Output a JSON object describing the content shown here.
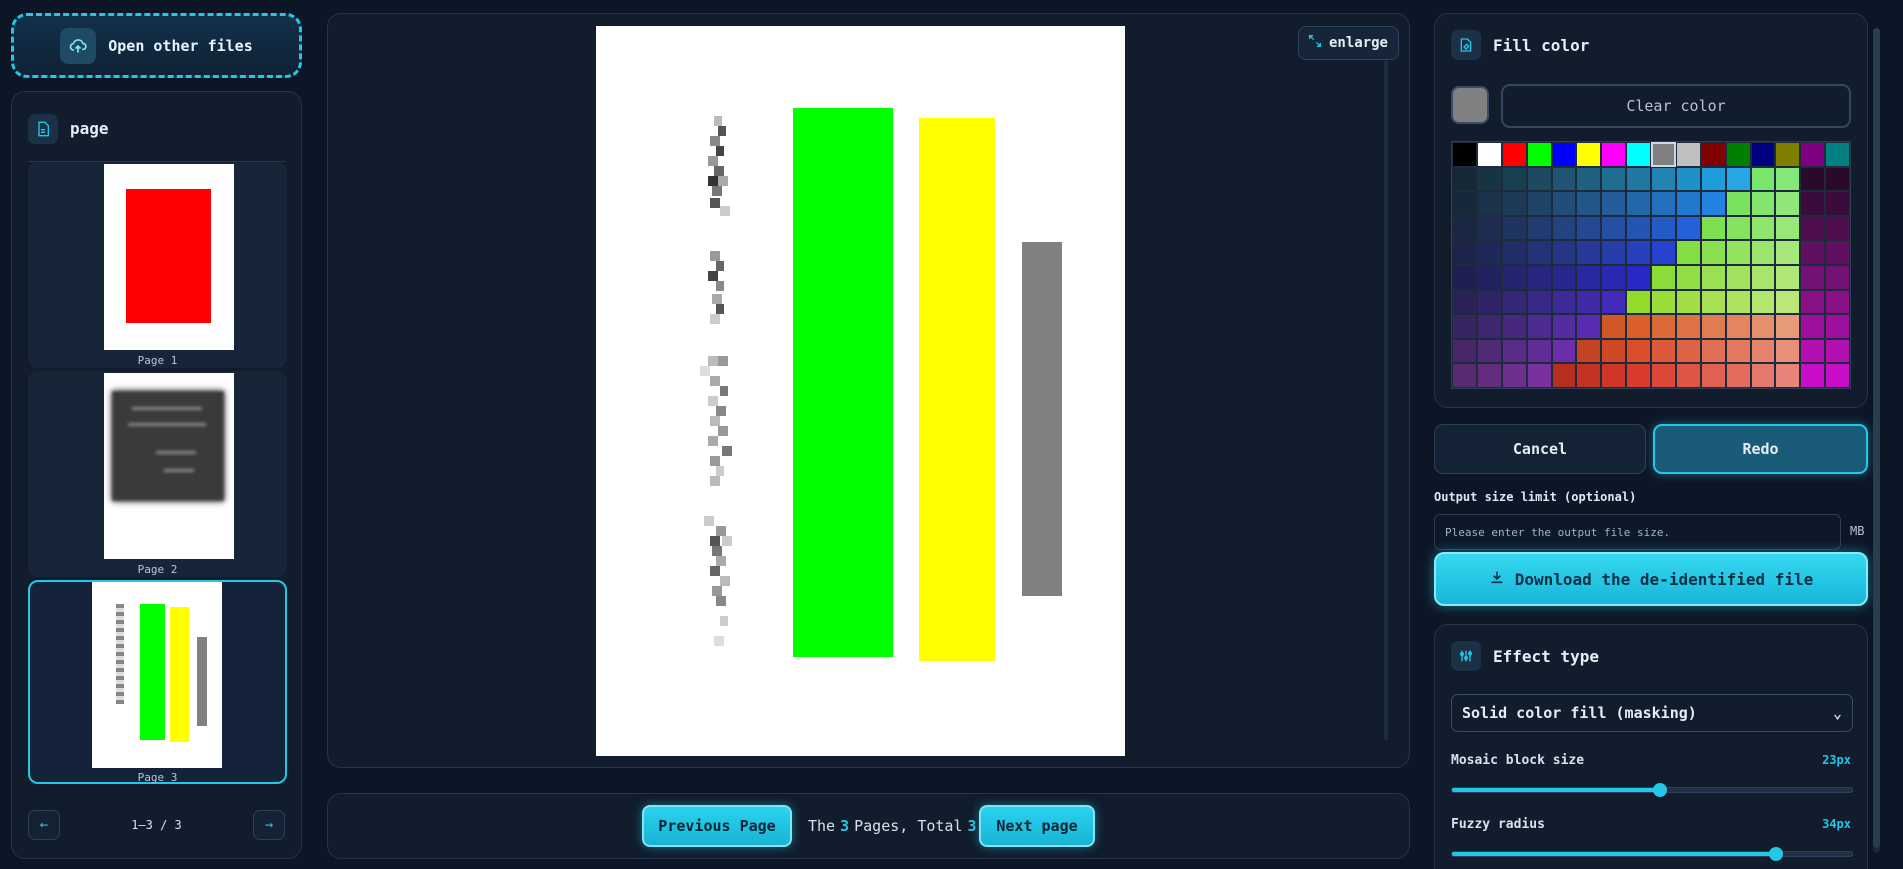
{
  "open_button": {
    "label": "Open other files",
    "icon": "cloud-upload-icon"
  },
  "pages_panel": {
    "title": "page",
    "icon": "document-icon",
    "thumbnails": [
      {
        "label": "Page 1"
      },
      {
        "label": "Page 2"
      },
      {
        "label": "Page 3"
      }
    ],
    "pager_text": "1–3 / 3"
  },
  "viewer": {
    "enlarge_label": "enlarge",
    "page_colors": {
      "green": "#00ff00",
      "yellow": "#ffff00",
      "gray": "#808080"
    }
  },
  "footer": {
    "prev_label": "Previous Page",
    "the": "The",
    "current": "3",
    "pages_total": "Pages, Total",
    "total": "3",
    "next_label": "Next page"
  },
  "fill_color": {
    "title": "Fill color",
    "icon": "paint-bucket-icon",
    "current_color": "#808080",
    "clear_label": "Clear color"
  },
  "actions": {
    "cancel_label": "Cancel",
    "redo_label": "Redo"
  },
  "output": {
    "label": "Output size limit (optional)",
    "placeholder": "Please enter the output file size.",
    "unit": "MB"
  },
  "download_label": "Download the de-identified file",
  "effect": {
    "title": "Effect type",
    "icon": "sliders-icon",
    "selected": "Solid color fill (masking)",
    "mosaic_label": "Mosaic block size",
    "mosaic_value": "23px",
    "mosaic_fraction": 0.52,
    "fuzzy_label": "Fuzzy radius",
    "fuzzy_value": "34px",
    "fuzzy_fraction": 0.81
  },
  "accent_color": "#22c8e6"
}
